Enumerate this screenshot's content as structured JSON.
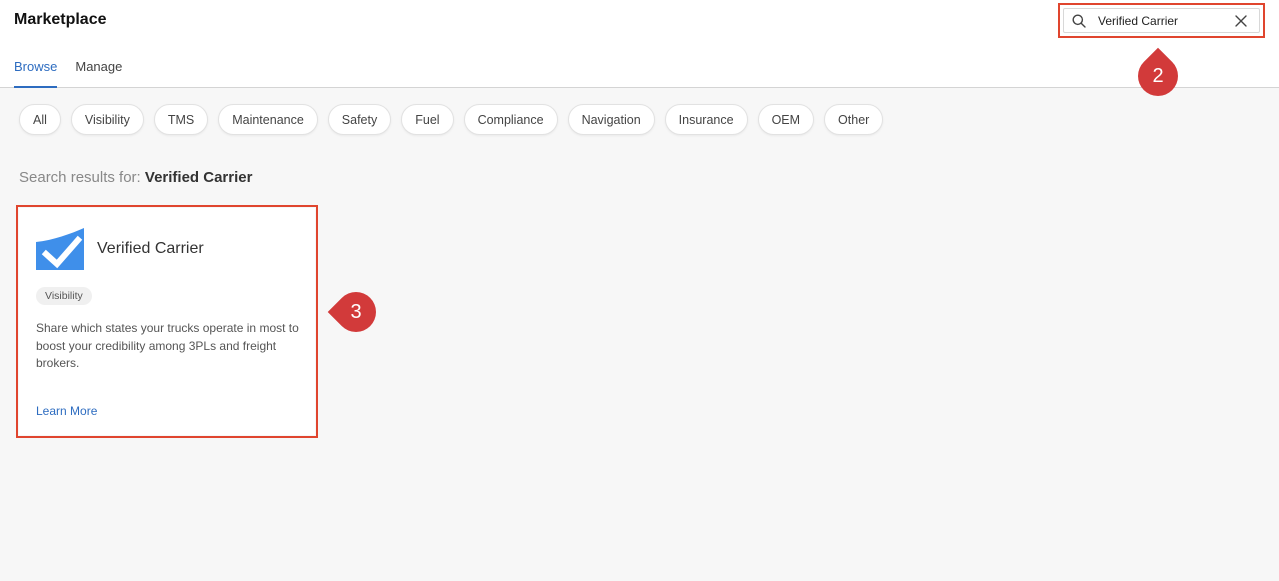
{
  "header": {
    "title": "Marketplace",
    "tabs": [
      {
        "label": "Browse",
        "active": true
      },
      {
        "label": "Manage",
        "active": false
      }
    ],
    "search": {
      "value": "Verified Carrier",
      "placeholder": ""
    }
  },
  "markers": {
    "search": "2",
    "card": "3"
  },
  "filters": [
    "All",
    "Visibility",
    "TMS",
    "Maintenance",
    "Safety",
    "Fuel",
    "Compliance",
    "Navigation",
    "Insurance",
    "OEM",
    "Other"
  ],
  "results": {
    "prefix": "Search results for:",
    "query": "Verified Carrier"
  },
  "card": {
    "name": "Verified Carrier",
    "tag": "Visibility",
    "description": "Share which states your trucks operate in most to boost your credibility among 3PLs and freight brokers.",
    "link": "Learn More"
  },
  "colors": {
    "accent": "#2d6cc0",
    "highlight": "#e0452e",
    "marker": "#d23a3a",
    "logo": "#3f8fea"
  }
}
